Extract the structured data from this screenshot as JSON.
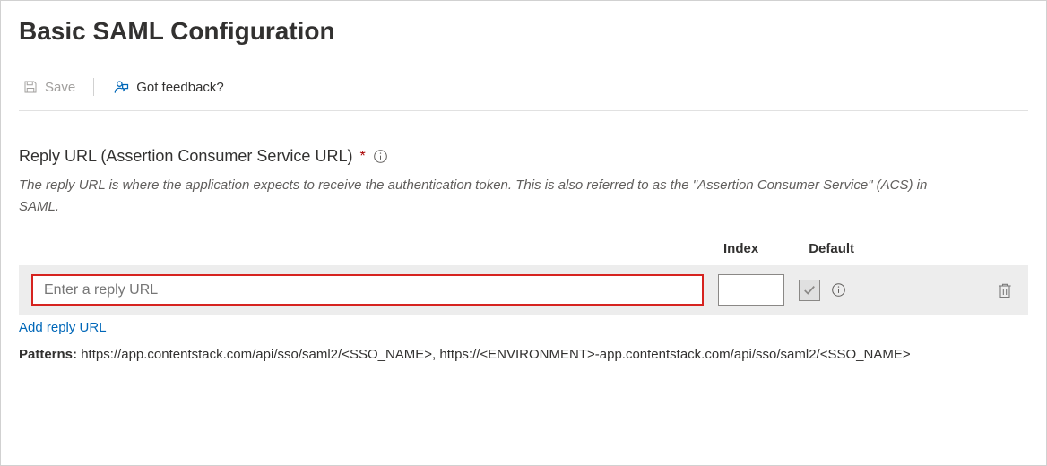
{
  "title": "Basic SAML Configuration",
  "toolbar": {
    "save_label": "Save",
    "feedback_label": "Got feedback?"
  },
  "section": {
    "label": "Reply URL (Assertion Consumer Service URL)",
    "required_mark": "*",
    "description": "The reply URL is where the application expects to receive the authentication token. This is also referred to as the \"Assertion Consumer Service\" (ACS) in SAML.",
    "columns": {
      "index": "Index",
      "default": "Default"
    },
    "input": {
      "placeholder": "Enter a reply URL",
      "value": "",
      "index_value": ""
    },
    "add_link": "Add reply URL",
    "patterns_label": "Patterns:",
    "patterns_value": "https://app.contentstack.com/api/sso/saml2/<SSO_NAME>, https://<ENVIRONMENT>-app.contentstack.com/api/sso/saml2/<SSO_NAME>"
  }
}
